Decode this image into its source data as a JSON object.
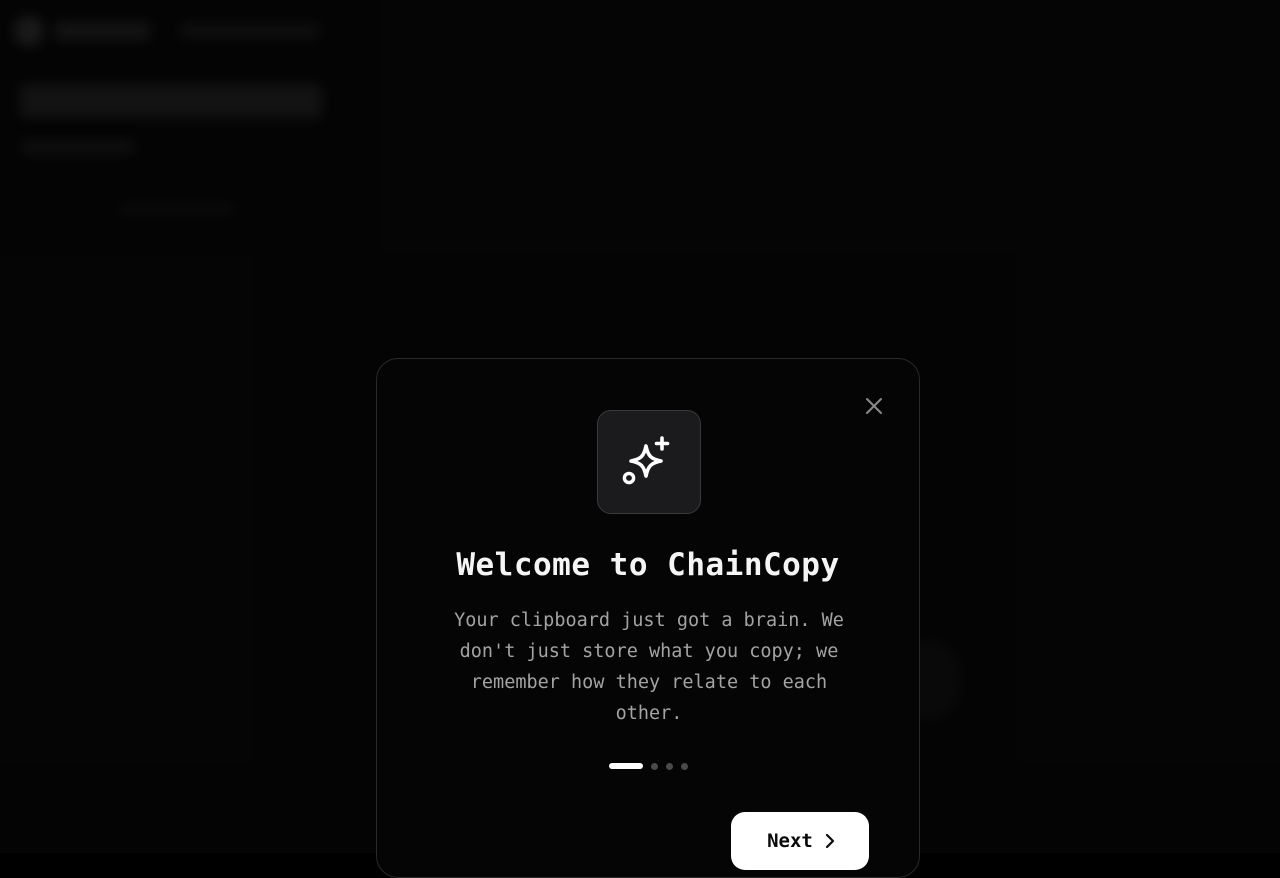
{
  "modal": {
    "title": "Welcome to ChainCopy",
    "description": "Your clipboard just got a brain. We don't just store what you copy; we remember how they relate to each other.",
    "step_indicator": {
      "total": 4,
      "current": 1
    },
    "next_label": "Next",
    "icons": {
      "close": "close-icon",
      "hero": "sparkles-icon",
      "next": "chevron-right-icon"
    }
  },
  "colors": {
    "background": "#000000",
    "modal_bg": "#050505",
    "modal_border": "#2a2a2a",
    "title_text": "#f5f5f5",
    "body_text": "#a3a3a3",
    "button_bg": "#ffffff",
    "button_text": "#0a0a0a",
    "dot_active": "#ffffff",
    "dot_inactive": "#4a4a4a"
  }
}
